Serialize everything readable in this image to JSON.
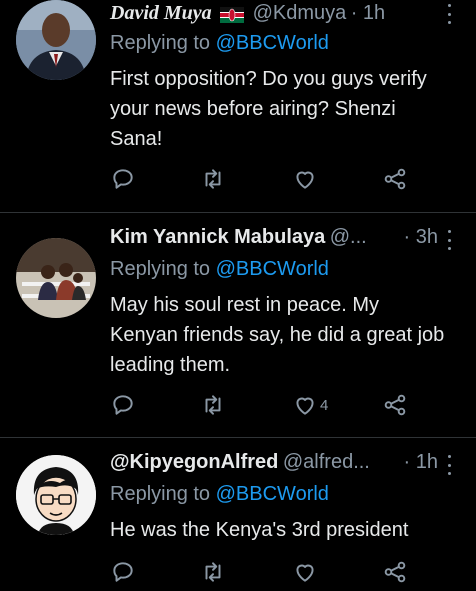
{
  "tweets": [
    {
      "name": "David Muya",
      "has_flag": true,
      "handle": "@Kdmuya",
      "time": "· 1h",
      "replying_prefix": "Replying to ",
      "replying_to": "@BBCWorld",
      "text": "First opposition? Do you guys verify your news before airing? Shenzi Sana!",
      "likes": ""
    },
    {
      "name": "Kim Yannick Mabulaya",
      "handle": "@...",
      "time": "· 3h",
      "replying_prefix": "Replying to ",
      "replying_to": "@BBCWorld",
      "text": "May his soul rest in peace. My Kenyan friends say, he did a great job leading them.",
      "likes": "4"
    },
    {
      "name": "@KipyegonAlfred",
      "handle": "@alfred...",
      "time": "· 1h",
      "replying_prefix": "Replying to ",
      "replying_to": "@BBCWorld",
      "text": "He was the Kenya's 3rd president",
      "likes": ""
    }
  ],
  "icons": [
    "reply-icon",
    "retweet-icon",
    "like-icon",
    "share-icon",
    "more-icon",
    "kenya-flag-icon"
  ],
  "colors": {
    "background": "#000000",
    "text": "#e7e9ea",
    "muted": "#8b98a5",
    "link": "#1d9bf0",
    "divider": "#2f3336"
  }
}
